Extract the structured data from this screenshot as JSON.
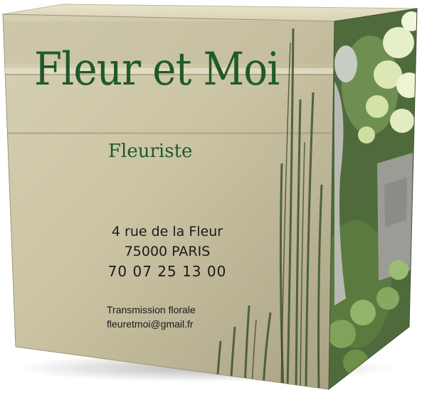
{
  "brand": {
    "name": "Fleur et Moi",
    "tagline": "Fleuriste"
  },
  "contact": {
    "street": "4 rue de la Fleur",
    "city": "75000 PARIS",
    "phone": "70 07 25 13 00",
    "service": "Transmission florale",
    "email": "fleuretmoi@gmail.fr"
  },
  "colors": {
    "brand_green": "#1f5a2a",
    "card_beige": "#cdc6a6",
    "text_dark": "#1a1a1a"
  }
}
